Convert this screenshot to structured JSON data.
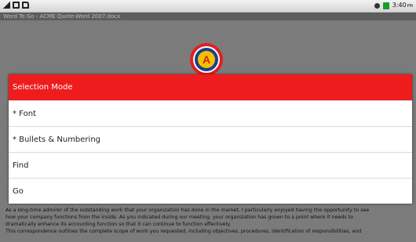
{
  "status_bar": {
    "time": "3:40",
    "time_suffix": "PM",
    "left_icons": [
      "signal-icon",
      "usb-icon",
      "sd-card-icon"
    ],
    "right_icons": [
      "sync-icon",
      "battery-icon"
    ]
  },
  "window": {
    "title": "Word To Go - ACME Quote-Word 2007.docx"
  },
  "document": {
    "logo": {
      "letter": "A",
      "colors": [
        "#e02020",
        "#1b3f8f",
        "#f2c200"
      ]
    },
    "paragraph_lines": [
      "As a long-time admirer of the outstanding work that your organization has done in the market, I particularly enjoyed having the opportunity to see",
      "how your company functions from the inside. As you indicated during our meeting, your organization has grown to a point where it needs to",
      "dramatically enhance its accounting function so that it can continue to function effectively.",
      "This correspondence outlines the complete scope of work you requested, including objectives, procedures, identification of responsibilities, and"
    ]
  },
  "dialog": {
    "title": "Selection Mode",
    "accent_color": "#ee1c1c",
    "items": [
      {
        "label": "* Font"
      },
      {
        "label": "* Bullets & Numbering"
      },
      {
        "label": "Find"
      },
      {
        "label": "Go"
      }
    ]
  }
}
